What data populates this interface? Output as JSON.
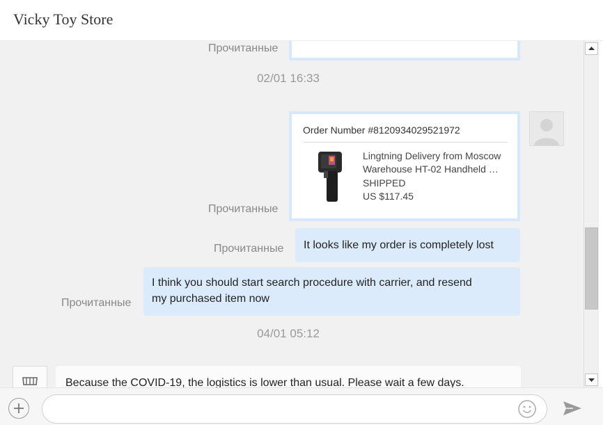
{
  "header": {
    "title": "Vicky Toy Store"
  },
  "messages": {
    "read_label": "Прочитанные",
    "timestamp_1": "02/01 16:33",
    "order_card": {
      "order_number": "Order Number #8120934029521972",
      "product_name_line1": "Lingtning Delivery from Moscow",
      "product_name_line2": "Warehouse HT-02 Handheld …",
      "status": "SHIPPED",
      "price": "US $117.45"
    },
    "msg_lost": "It looks like my order is completely lost",
    "msg_search_line1": "I think you should start search procedure with carrier, and resend",
    "msg_search_line2": "my purchased item now",
    "timestamp_2": "04/01 05:12",
    "msg_covid": "Because the COVID-19, the logistics is lower than usual. Please wait a few days."
  },
  "icons": {
    "plus": "plus-icon",
    "emoji": "emoji-icon",
    "send": "send-icon",
    "avatar_user": "user-avatar-icon",
    "avatar_store": "store-icon"
  },
  "colors": {
    "outgoing_bubble": "#dcebfc",
    "card_border": "#d8e8fb",
    "chat_background": "#f1f1f1"
  }
}
